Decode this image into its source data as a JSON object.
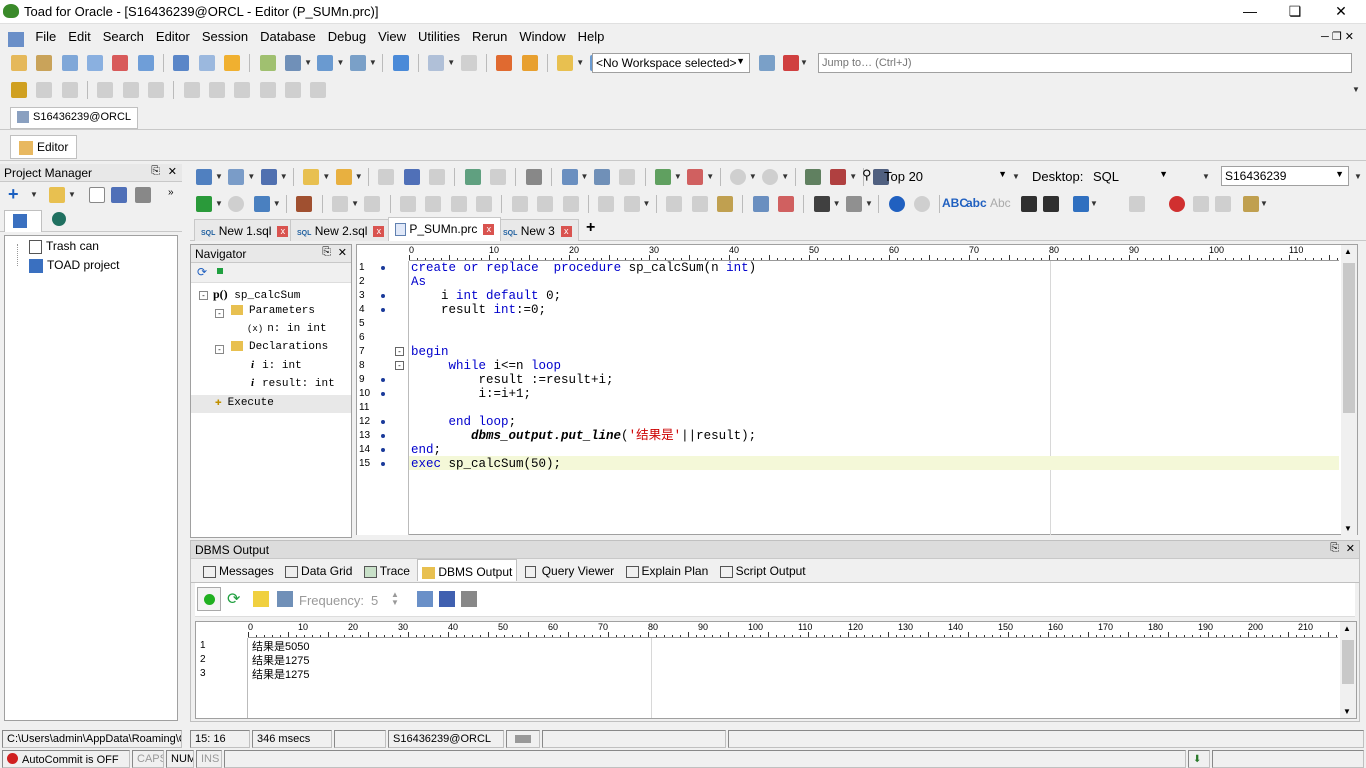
{
  "window": {
    "title": "Toad for Oracle - [S16436239@ORCL - Editor (P_SUMn.prc)]"
  },
  "menu": [
    "File",
    "Edit",
    "Search",
    "Editor",
    "Session",
    "Database",
    "Debug",
    "View",
    "Utilities",
    "Rerun",
    "Window",
    "Help"
  ],
  "toolbar": {
    "workspace": "<No Workspace selected>",
    "jump_placeholder": "Jump to… (Ctrl+J)"
  },
  "connection_tab": "S16436239@ORCL",
  "window_tab": "Editor",
  "project_manager": {
    "title": "Project Manager",
    "items": [
      "Trash can",
      "TOAD project"
    ]
  },
  "editor_toolbar": {
    "rows_limit": "Top 20",
    "desktop_label": "Desktop:",
    "desktop_value": "SQL",
    "schema": "S16436239"
  },
  "editor_tabs": [
    {
      "label": "New 1.sql"
    },
    {
      "label": "New 2.sql"
    },
    {
      "label": "P_SUMn.prc"
    },
    {
      "label": "New 3"
    }
  ],
  "navigator": {
    "title": "Navigator",
    "proc_prefix": "p()",
    "proc_name": "sp_calcSum",
    "parameters": "Parameters",
    "param1": "n: in int",
    "declarations": "Declarations",
    "decl1": "i: int",
    "decl2": "result: int",
    "execute": "Execute"
  },
  "ruler_labels": [
    "0",
    "10",
    "20",
    "30",
    "40",
    "50",
    "60",
    "70",
    "80",
    "90",
    "100",
    "110"
  ],
  "code": {
    "lines": [
      {
        "n": "1",
        "text": "create or replace  procedure sp_calcSum(n int)"
      },
      {
        "n": "2",
        "text": "As"
      },
      {
        "n": "3",
        "text": "    i int default 0;"
      },
      {
        "n": "4",
        "text": "    result int:=0;"
      },
      {
        "n": "5",
        "text": ""
      },
      {
        "n": "6",
        "text": ""
      },
      {
        "n": "7",
        "text": "begin"
      },
      {
        "n": "8",
        "text": "     while i<=n loop"
      },
      {
        "n": "9",
        "text": "         result :=result+i;"
      },
      {
        "n": "10",
        "text": "         i:=i+1;"
      },
      {
        "n": "11",
        "text": ""
      },
      {
        "n": "12",
        "text": "     end loop;"
      },
      {
        "n": "13",
        "text": "        dbms_output.put_line('结果是'||result);"
      },
      {
        "n": "14",
        "text": "end;"
      },
      {
        "n": "15",
        "text": "exec sp_calcSum(50);"
      }
    ]
  },
  "dbms_output": {
    "title": "DBMS Output",
    "tabs": [
      "Messages",
      "Data Grid",
      "Trace",
      "DBMS Output",
      "Query Viewer",
      "Explain Plan",
      "Script Output"
    ],
    "frequency_label": "Frequency:",
    "frequency_value": "5",
    "ruler_labels": [
      "0",
      "10",
      "20",
      "30",
      "40",
      "50",
      "60",
      "70",
      "80",
      "90",
      "100",
      "110",
      "120",
      "130",
      "140",
      "150",
      "160",
      "170",
      "180",
      "190",
      "200",
      "210"
    ],
    "rows": [
      {
        "n": "1",
        "text": "结果是5050"
      },
      {
        "n": "2",
        "text": "结果是1275"
      },
      {
        "n": "3",
        "text": "结果是1275"
      }
    ]
  },
  "statusbar": {
    "path": "C:\\Users\\admin\\AppData\\Roaming\\Q",
    "position": "15:  16",
    "time": "346 msecs",
    "connection": "S16436239@ORCL",
    "autocommit": "AutoCommit is OFF",
    "caps": "CAPS",
    "num": "NUM",
    "ins": "INS"
  }
}
